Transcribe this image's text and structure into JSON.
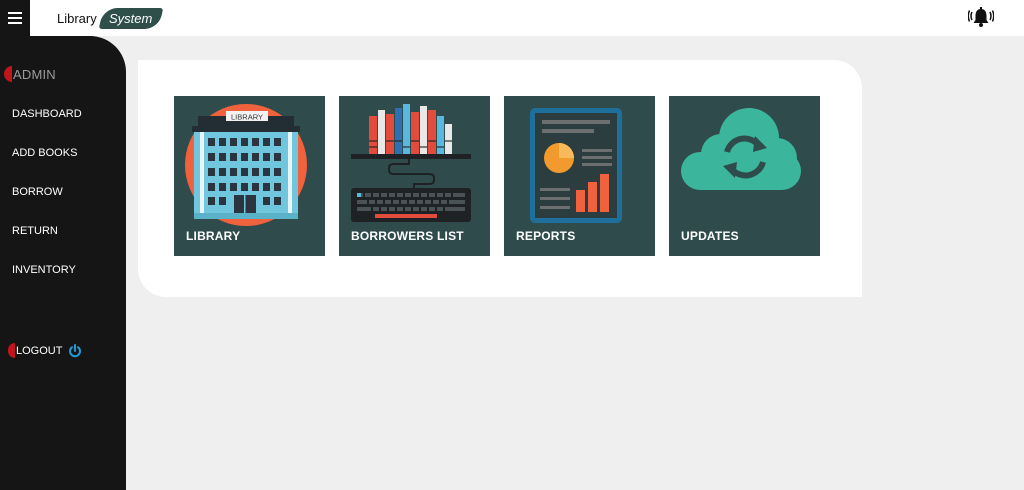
{
  "header": {
    "brand_primary": "Library",
    "brand_secondary": "System",
    "menu_icon": "hamburger-icon",
    "notification_icon": "alarm-bell-icon"
  },
  "sidebar": {
    "user_label": "ADMIN",
    "items": [
      {
        "label": "DASHBOARD"
      },
      {
        "label": "ADD BOOKS"
      },
      {
        "label": "BORROW"
      },
      {
        "label": "RETURN"
      },
      {
        "label": "INVENTORY"
      }
    ],
    "logout_label": "LOGOUT",
    "logout_icon": "power-icon"
  },
  "tiles": [
    {
      "label": "LIBRARY",
      "building_sign": "LIBRARY",
      "icon": "library-building-icon"
    },
    {
      "label": "BORROWERS LIST",
      "icon": "bookshelf-keyboard-icon"
    },
    {
      "label": "REPORTS",
      "icon": "report-tablet-icon"
    },
    {
      "label": "UPDATES",
      "icon": "cloud-sync-icon"
    }
  ],
  "colors": {
    "sidebar_bg": "#151515",
    "tile_bg": "#2f4b4b",
    "accent_red": "#c0151b",
    "brand_green": "#2f4f4a",
    "power_blue": "#1e9ad6",
    "cloud_teal": "#3bb59b",
    "orange": "#f0623d"
  }
}
